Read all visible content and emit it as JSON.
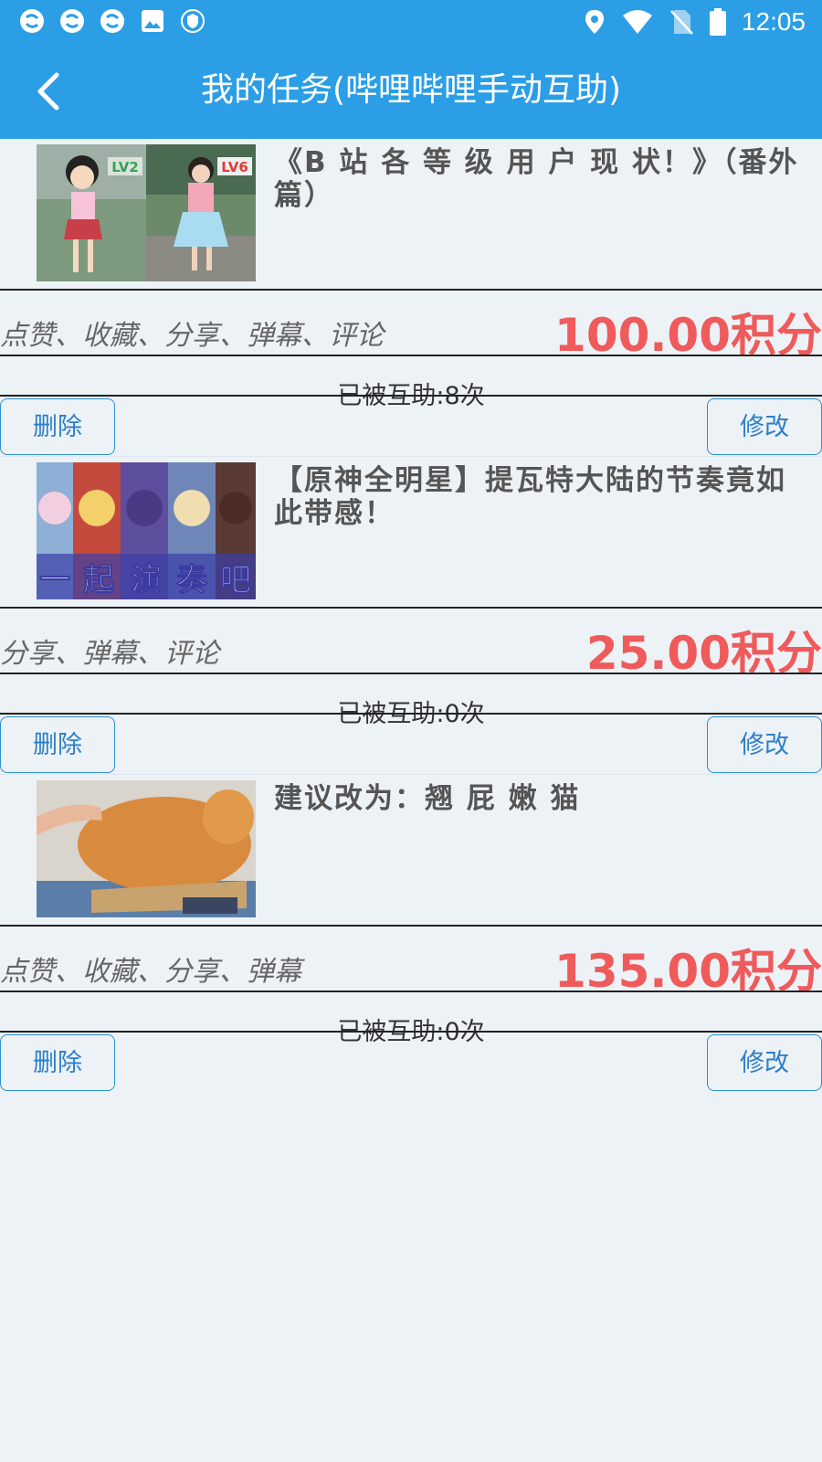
{
  "status_bar": {
    "time": "12:05",
    "left_icons": [
      "sync-icon",
      "sync-icon",
      "sync-icon",
      "image-icon",
      "shield-icon"
    ],
    "right_icons": [
      "location-icon",
      "wifi-icon",
      "no-sim-icon",
      "battery-icon"
    ]
  },
  "header": {
    "title": "我的任务(哔哩哔哩手动互助)",
    "back_icon": "chevron-left-icon",
    "bg_color": "#2b9ee6"
  },
  "tasks": [
    {
      "title": "《B 站 各 等 级 用 户 现 状！》（番外篇）",
      "actions": "点赞、收藏、分享、弹幕、评论",
      "points": "100.00积分",
      "assist_count": "已被互助:8次",
      "delete_label": "删除",
      "edit_label": "修改",
      "thumb_text": [
        "LV2",
        "LV6"
      ]
    },
    {
      "title": "【原神全明星】提瓦特大陆的节奏竟如此带感！",
      "actions": "分享、弹幕、评论",
      "points": "25.00积分",
      "assist_count": "已被互助:0次",
      "delete_label": "删除",
      "edit_label": "修改",
      "thumb_text": [
        "一",
        "起",
        "演",
        "奏",
        "吧"
      ]
    },
    {
      "title": "建议改为：翘 屁 嫩 猫",
      "actions": "点赞、收藏、分享、弹幕",
      "points": "135.00积分",
      "assist_count": "已被互助:0次",
      "delete_label": "删除",
      "edit_label": "修改",
      "thumb_text": []
    }
  ],
  "colors": {
    "accent": "#2b9ee6",
    "points": "#ef5a5a",
    "background": "#edf2f7"
  }
}
